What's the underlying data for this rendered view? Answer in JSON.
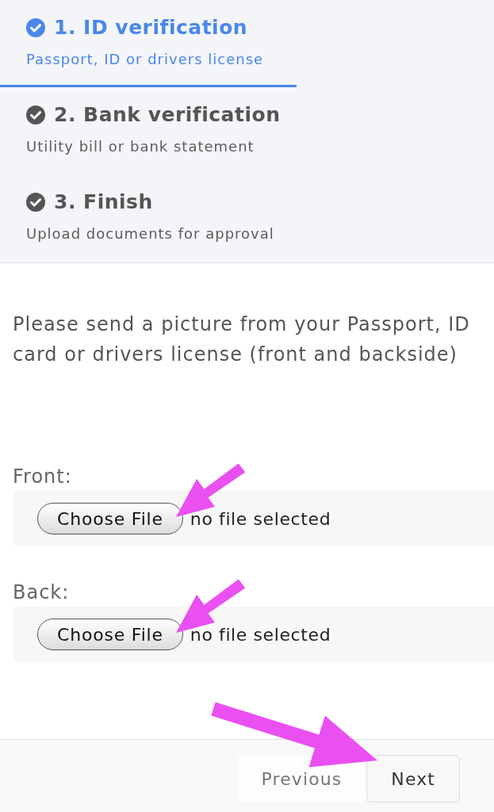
{
  "steps": [
    {
      "title": "1. ID verification",
      "subtitle": "Passport, ID or drivers license",
      "selected": true
    },
    {
      "title": "2. Bank verification",
      "subtitle": "Utility bill or bank statement",
      "selected": false
    },
    {
      "title": "3. Finish",
      "subtitle": "Upload documents for approval",
      "selected": false
    }
  ],
  "instructions": "Please send a picture from your Passport, ID card or drivers license (front and backside)",
  "uploads": [
    {
      "label": "Front:",
      "button": "Choose File",
      "status": "no file selected"
    },
    {
      "label": "Back:",
      "button": "Choose File",
      "status": "no file selected"
    }
  ],
  "footer": {
    "buttons": [
      {
        "label": "Previous",
        "disabled": true
      },
      {
        "label": "Next",
        "disabled": false
      }
    ]
  }
}
